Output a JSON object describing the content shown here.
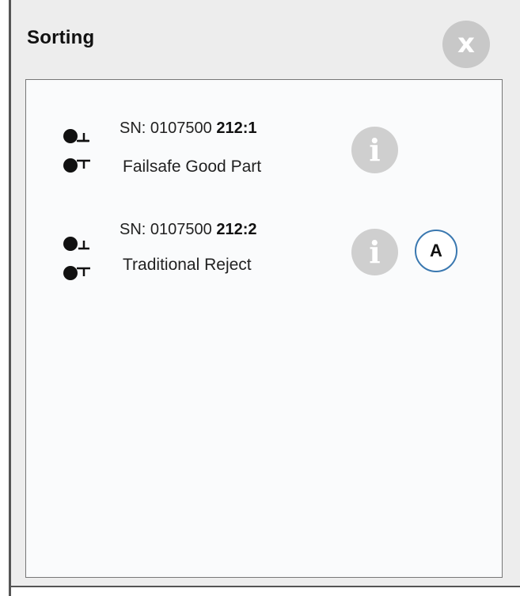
{
  "panel": {
    "title": "Sorting",
    "close_icon": "close-icon"
  },
  "outputs": [
    {
      "sn_prefix": "SN: 0107500 ",
      "sn_id": "212:1",
      "description": "Failsafe Good Part",
      "icon": "output-terminal-icon",
      "info_icon": "info-icon"
    },
    {
      "sn_prefix": "SN: 0107500 ",
      "sn_id": "212:2",
      "description": "Traditional Reject",
      "icon": "output-terminal-icon",
      "info_icon": "info-icon"
    }
  ],
  "callout": {
    "label": "A",
    "border_color": "#3a78b0"
  },
  "colors": {
    "panel_bg": "#ededed",
    "content_bg": "#fafbfc",
    "button_gray": "#c8c8c8"
  }
}
